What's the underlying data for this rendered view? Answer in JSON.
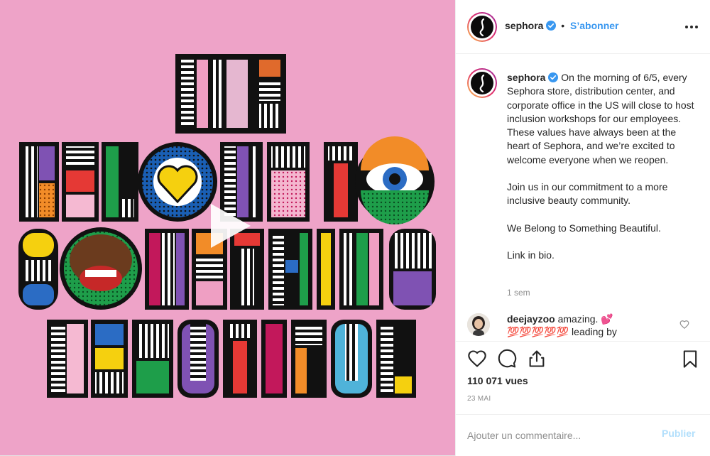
{
  "media": {
    "artwork_lines": [
      "WE",
      "BELONG TO",
      "SOMETHING",
      "BEAUTIFUL"
    ],
    "play_icon": "play-icon"
  },
  "header": {
    "username": "sephora",
    "separator": "•",
    "follow_label": "S’abonner",
    "more_icon": "more-horizontal-icon"
  },
  "caption": {
    "username": "sephora",
    "paragraphs": [
      "On the morning of 6/5, every Sephora store, distribution center, and corporate office in the US will close to host inclusion workshops for our employees. These values have always been at the heart of Sephora, and we’re excited to welcome everyone when we reopen.",
      "Join us in our commitment to a more inclusive beauty community.",
      "We Belong to Something Beautiful.",
      "Link in bio."
    ],
    "time_ago": "1 sem"
  },
  "comments": [
    {
      "username": "deejayzoo",
      "text": "amazing. 💕",
      "second_line": "💯💯💯💯💯 leading by"
    }
  ],
  "actions": {
    "like_icon": "heart-icon",
    "comment_icon": "comment-icon",
    "share_icon": "share-icon",
    "save_icon": "bookmark-icon"
  },
  "stats": {
    "views": "110 071 vues",
    "date": "23 mai"
  },
  "comment_form": {
    "placeholder": "Ajouter un commentaire...",
    "publish_label": "Publier"
  },
  "colors": {
    "background_pink": "#eea3c8",
    "link_blue": "#3897f0",
    "publish_disabled": "#b2dffc"
  }
}
